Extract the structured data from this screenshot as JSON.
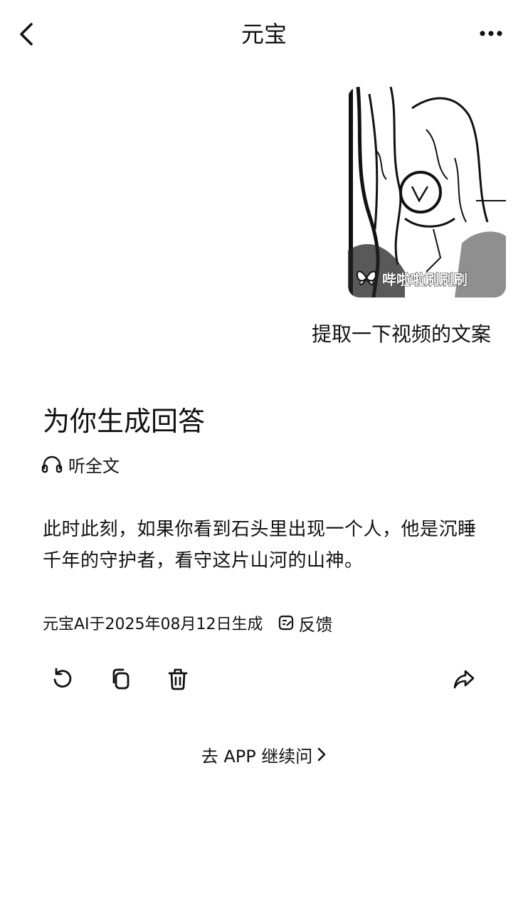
{
  "header": {
    "title": "元宝",
    "back_icon": "chevron-left-icon",
    "more_icon": "more-horizontal-icon"
  },
  "chat": {
    "video_attachment": {
      "watermark_text": "哔啦啦刷刷刷",
      "watermark_icon": "butterfly-logo-icon"
    },
    "user_message": "提取一下视频的文案"
  },
  "answer": {
    "title": "为你生成回答",
    "listen_label": "听全文",
    "listen_icon": "headphones-icon",
    "text": "此时此刻，如果你看到石头里出现一个人，他是沉睡千年的守护者，看守这片山河的山神。",
    "meta": "元宝AI于2025年08月12日生成",
    "feedback_label": "反馈",
    "feedback_icon": "feedback-edit-icon",
    "actions": [
      "refresh-icon",
      "copy-icon",
      "trash-icon",
      "share-icon"
    ]
  },
  "footer": {
    "continue_label": "去 APP 继续问",
    "continue_icon": "chevron-right-icon"
  }
}
